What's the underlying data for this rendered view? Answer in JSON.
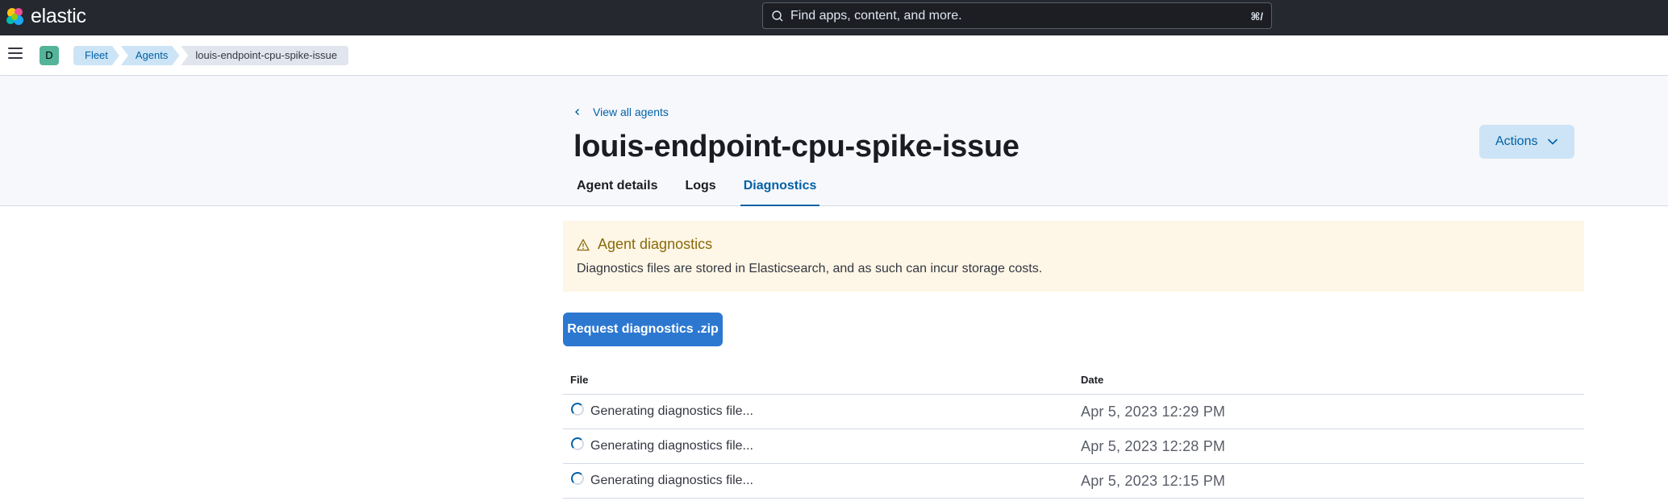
{
  "header": {
    "brand": "elastic",
    "search_placeholder": "Find apps, content, and more.",
    "search_shortcut": "⌘/"
  },
  "nav": {
    "space_initial": "D",
    "breadcrumbs": [
      "Fleet",
      "Agents",
      "louis-endpoint-cpu-spike-issue"
    ]
  },
  "page": {
    "back_link": "View all agents",
    "title": "louis-endpoint-cpu-spike-issue",
    "actions_label": "Actions",
    "tabs": [
      {
        "label": "Agent details",
        "active": false
      },
      {
        "label": "Logs",
        "active": false
      },
      {
        "label": "Diagnostics",
        "active": true
      }
    ]
  },
  "callout": {
    "title": "Agent diagnostics",
    "body": "Diagnostics files are stored in Elasticsearch, and as such can incur storage costs.",
    "icon": "warning-icon"
  },
  "request_button": "Request diagnostics .zip",
  "table": {
    "columns": [
      "File",
      "Date"
    ],
    "rows": [
      {
        "file": "Generating diagnostics file...",
        "date": "Apr 5, 2023 12:29 PM"
      },
      {
        "file": "Generating diagnostics file...",
        "date": "Apr 5, 2023 12:28 PM"
      },
      {
        "file": "Generating diagnostics file...",
        "date": "Apr 5, 2023 12:15 PM"
      }
    ]
  },
  "colors": {
    "topbar": "#25282f",
    "link": "#0061a6",
    "primary_button": "#2c78d1",
    "callout_bg": "#fef6e6",
    "space_avatar": "#54b399"
  }
}
